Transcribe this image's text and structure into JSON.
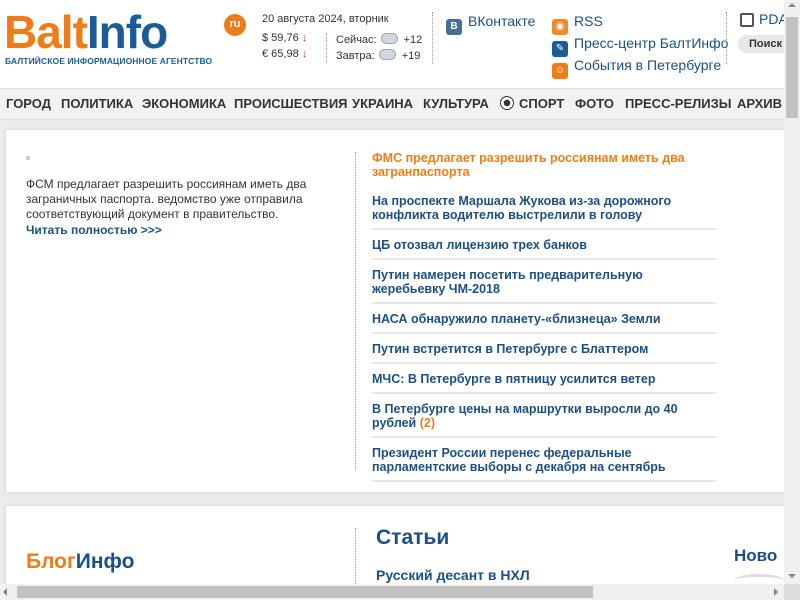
{
  "header": {
    "logo": {
      "part1": "Balt",
      "part2": "Info",
      "ru": "ru",
      "subtitle": "БАЛТИЙСКОЕ ИНФОРМАЦИОННОЕ АГЕНТСТВО"
    },
    "date": "20 августа 2024, вторник",
    "currency": [
      {
        "label": "$ 59,76",
        "trend": "↓"
      },
      {
        "label": "€ 65,98",
        "trend": "↓"
      }
    ],
    "weather": [
      {
        "label": "Сейчас:",
        "icon": "cloud-icon",
        "value": "+12"
      },
      {
        "label": "Завтра:",
        "icon": "rain-cloud-icon",
        "value": "+19"
      }
    ],
    "social": [
      {
        "icon": "vk-icon",
        "label": "ВКонтакте"
      },
      {
        "icon": "rss-icon",
        "label": "RSS"
      },
      {
        "icon": "press-center-icon",
        "label": "Пресс-центр БалтИнфо"
      },
      {
        "icon": "events-icon",
        "label": "События в Петербурге"
      }
    ],
    "pda": {
      "icon": "pda-icon",
      "label": "PDA"
    },
    "search_label": "Поиск"
  },
  "nav": [
    "ГОРОД",
    "ПОЛИТИКА",
    "ЭКОНОМИКА",
    "ПРОИСШЕСТВИЯ",
    "УКРАИНА",
    "КУЛЬТУРА",
    "СПОРТ",
    "ФОТО",
    "ПРЕСС-РЕЛИЗЫ",
    "АРХИВ"
  ],
  "lead": {
    "text": "ФСМ предлагает разрешить россиянам иметь два заграничных паспорта. ведомство уже отправила соответствующий документ в правительство.",
    "read_more": "Читать полностью >>>"
  },
  "news": [
    {
      "title": "ФМС предлагает разрешить россиянам иметь два загранпаспорта",
      "count": ""
    },
    {
      "title": "На проспекте Маршала Жукова из-за дорожного конфликта водителю выстрелили в голову",
      "count": ""
    },
    {
      "title": "ЦБ отозвал лицензию трех банков",
      "count": ""
    },
    {
      "title": "Путин намерен посетить предварительную жеребьевку ЧМ-2018",
      "count": ""
    },
    {
      "title": "НАСА обнаружило планету-«близнеца» Земли",
      "count": ""
    },
    {
      "title": "Путин встретится в Петербурге с Блаттером",
      "count": ""
    },
    {
      "title": "МЧС: В Петербурге в пятницу усилится ветер",
      "count": ""
    },
    {
      "title": "В Петербурге цены на маршрутки выросли до 40 рублей",
      "count": "(2)"
    },
    {
      "title": "Президент России перенес федеральные парламентские выборы с декабря на сентябрь",
      "count": ""
    }
  ],
  "bottom": {
    "blog_part1": "Блог",
    "blog_part2": "Инфо",
    "articles_title": "Статьи",
    "article_first": "Русский десант в НХЛ",
    "news_title": "Ново"
  }
}
